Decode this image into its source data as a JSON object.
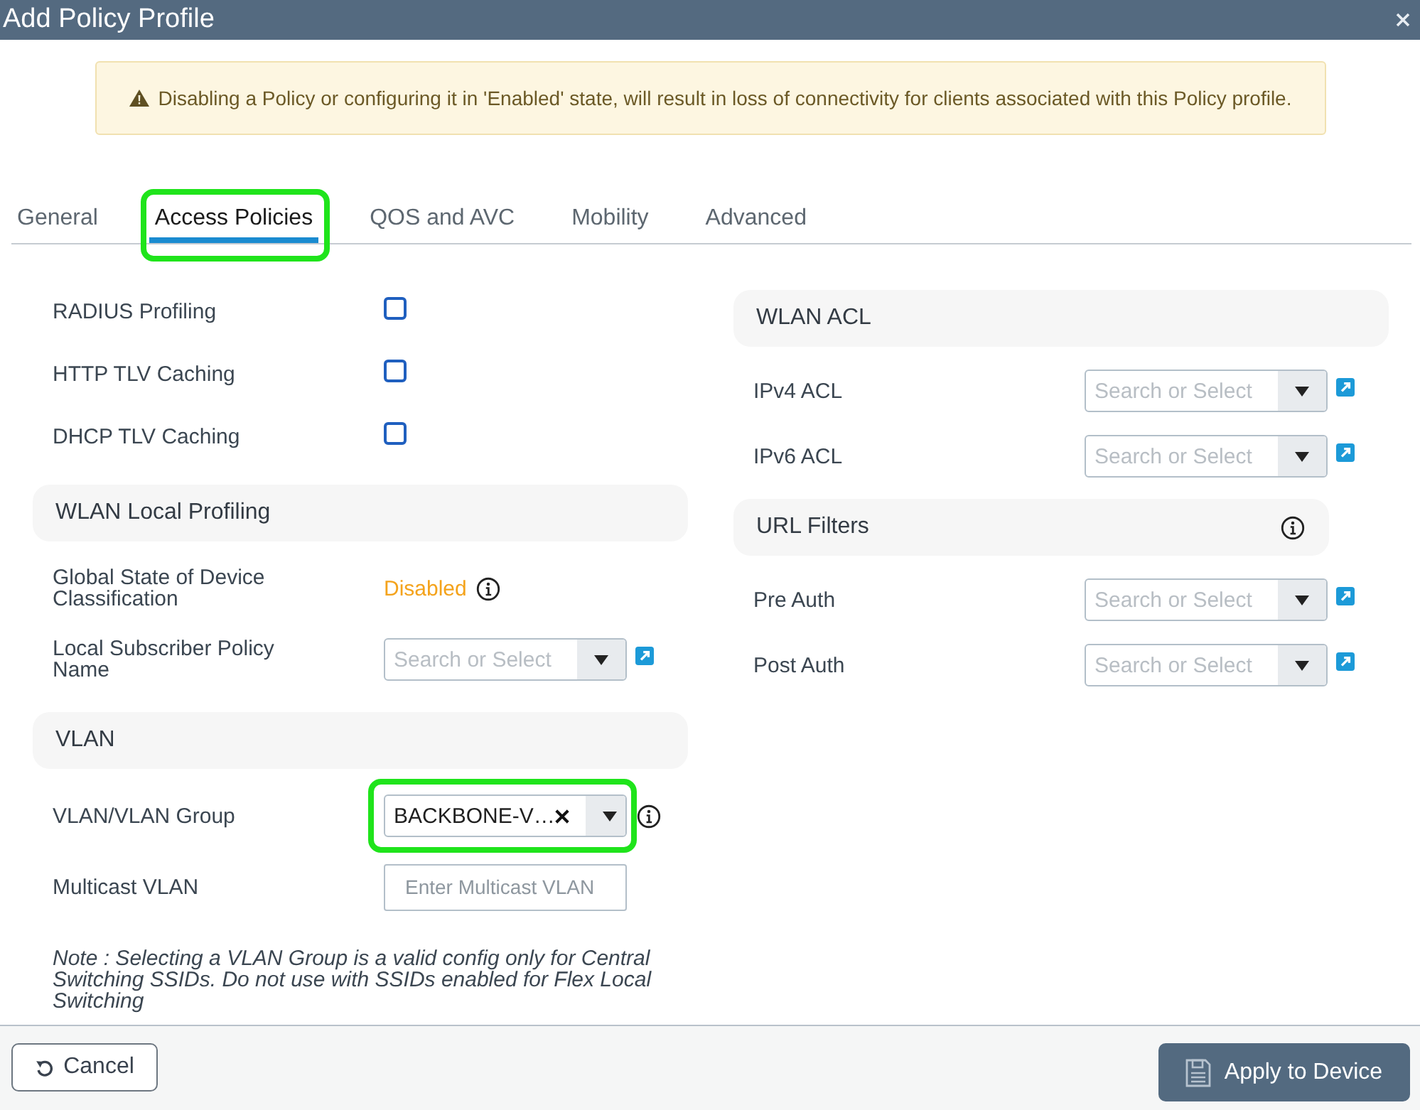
{
  "window": {
    "title": "Add Policy Profile"
  },
  "warning": {
    "text": "Disabling a Policy or configuring it in 'Enabled' state, will result in loss of connectivity for clients associated with this Policy profile."
  },
  "tabs": [
    {
      "label": "General",
      "selected": false
    },
    {
      "label": "Access Policies",
      "selected": true,
      "highlighted": true
    },
    {
      "label": "QOS and AVC",
      "selected": false
    },
    {
      "label": "Mobility",
      "selected": false
    },
    {
      "label": "Advanced",
      "selected": false
    }
  ],
  "left_column": [
    {
      "kind": "checkbox",
      "label": "RADIUS Profiling",
      "checked": false
    },
    {
      "kind": "checkbox",
      "label": "HTTP TLV Caching",
      "checked": false
    },
    {
      "kind": "checkbox",
      "label": "DHCP TLV Caching",
      "checked": false
    },
    {
      "kind": "section",
      "title": "WLAN Local Profiling"
    },
    {
      "kind": "status",
      "label": "Global State of Device Classification",
      "value": "Disabled",
      "info": true
    },
    {
      "kind": "select",
      "label": "Local Subscriber Policy Name",
      "placeholder": "Search or Select",
      "link": true
    },
    {
      "kind": "section",
      "title": "VLAN"
    },
    {
      "kind": "select",
      "label": "VLAN/VLAN Group",
      "value": "BACKBONE-V…",
      "clearable": true,
      "info": true,
      "highlighted": true
    },
    {
      "kind": "input",
      "label": "Multicast VLAN",
      "placeholder": "Enter Multicast VLAN"
    },
    {
      "kind": "note",
      "text": "Note : Selecting a VLAN Group is a valid config only for Central Switching SSIDs. Do not use with SSIDs enabled for Flex Local Switching"
    }
  ],
  "right_column": [
    {
      "kind": "section",
      "title": "WLAN ACL"
    },
    {
      "kind": "select",
      "label": "IPv4 ACL",
      "placeholder": "Search or Select",
      "link": true
    },
    {
      "kind": "select",
      "label": "IPv6 ACL",
      "placeholder": "Search or Select",
      "link": true
    },
    {
      "kind": "section",
      "title": "URL Filters",
      "info": true
    },
    {
      "kind": "select",
      "label": "Pre Auth",
      "placeholder": "Search or Select",
      "link": true
    },
    {
      "kind": "select",
      "label": "Post Auth",
      "placeholder": "Search or Select",
      "link": true
    }
  ],
  "footer": {
    "buttons": [
      {
        "kind": "cancel",
        "label": "Cancel"
      },
      {
        "kind": "apply",
        "label": "Apply to Device"
      }
    ]
  }
}
